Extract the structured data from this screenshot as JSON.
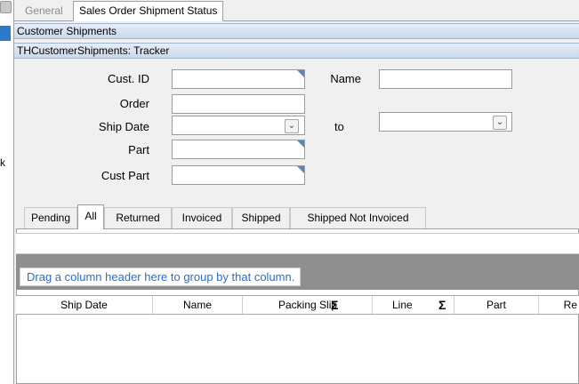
{
  "tabs": {
    "general": "General",
    "sales_order_shipment_status": "Sales Order Shipment Status"
  },
  "headers": {
    "customer_shipments": "Customer Shipments",
    "tracker": "THCustomerShipments: Tracker"
  },
  "sidebar": {
    "clipped_char": "k"
  },
  "form": {
    "cust_id_label": "Cust. ID",
    "name_label": "Name",
    "order_label": "Order",
    "ship_date_label": "Ship Date",
    "to_label": "to",
    "part_label": "Part",
    "cust_part_label": "Cust Part",
    "cust_id_value": "",
    "name_value": "",
    "order_value": "",
    "ship_date_from_value": "",
    "ship_date_to_value": "",
    "part_value": "",
    "cust_part_value": ""
  },
  "grid_tabs": [
    "Pending",
    "All",
    "Returned",
    "Invoiced",
    "Shipped",
    "Shipped Not Invoiced"
  ],
  "grid": {
    "group_hint": "Drag a column header here to group by that column.",
    "columns": [
      "Ship Date",
      "Name",
      "Packing Slip",
      "Line",
      "Part",
      "Re"
    ],
    "sigma": "Σ"
  },
  "icons": {
    "dropdown": "chevron-down-icon",
    "summary": "sigma-icon"
  },
  "colors": {
    "header_bar": "#c9d8ea",
    "selection": "#2a7bd0",
    "group_panel": "#8f8f8f",
    "link_text": "#2b6fc1"
  }
}
